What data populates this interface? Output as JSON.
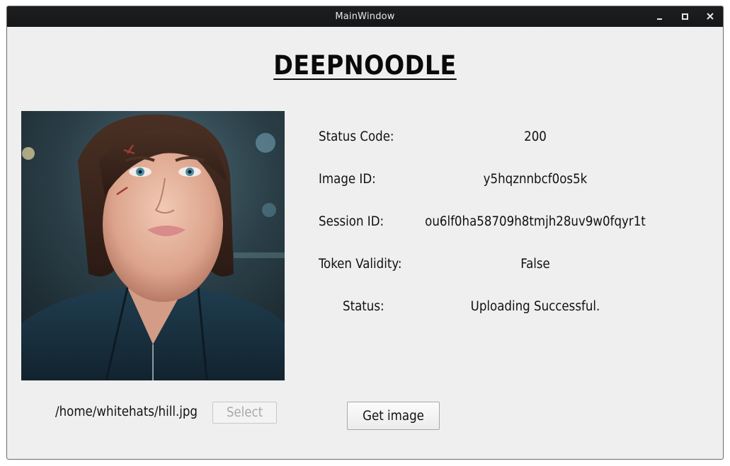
{
  "window": {
    "title": "MainWindow"
  },
  "app": {
    "title": "DEEPNOODLE"
  },
  "photo": {
    "subject": "portrait photo of a woman"
  },
  "fields": {
    "status_code": {
      "label": "Status Code:",
      "value": "200"
    },
    "image_id": {
      "label": "Image ID:",
      "value": "y5hqznnbcf0os5k"
    },
    "session_id": {
      "label": "Session ID:",
      "value": "ou6lf0ha58709h8tmjh28uv9w0fqyr1t"
    },
    "token_validity": {
      "label": "Token Validity:",
      "value": "False"
    },
    "status": {
      "label": "Status:",
      "value": "Uploading Successful."
    }
  },
  "file": {
    "path": "/home/whitehats/hill.jpg"
  },
  "buttons": {
    "select": "Select",
    "get_image": "Get image"
  },
  "icons": {
    "minimize": "minimize-icon",
    "maximize": "maximize-icon",
    "close": "close-icon"
  }
}
